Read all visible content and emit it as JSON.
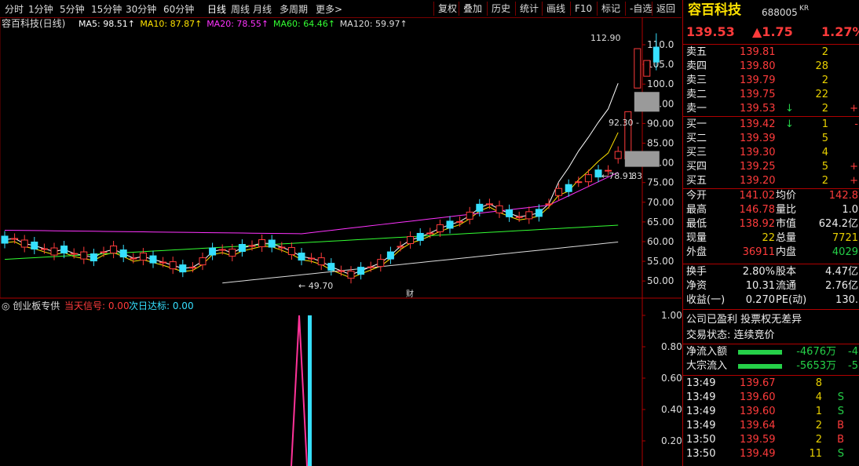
{
  "toolbar": {
    "periods": [
      "分时",
      "1分钟",
      "5分钟",
      "15分钟",
      "30分钟",
      "60分钟",
      "日线",
      "周线",
      "月线",
      "多周期",
      "更多>"
    ],
    "active_period": "日线",
    "actions": [
      "复权",
      "叠加",
      "历史",
      "统计",
      "画线",
      "F10",
      "标记",
      "-自选",
      "返回"
    ]
  },
  "chart": {
    "title": "容百科技(日线)",
    "ma_labels": [
      {
        "text": "MA5: 98.51↑",
        "color": "#ffffff"
      },
      {
        "text": "MA10: 87.87↑",
        "color": "#ffe300"
      },
      {
        "text": "MA20: 78.55↑",
        "color": "#ff33ff"
      },
      {
        "text": "MA60: 64.46↑",
        "color": "#33ff33"
      },
      {
        "text": "MA120: 59.97↑",
        "color": "#dddddd"
      }
    ],
    "y_ticks": [
      "110.0",
      "105.0",
      "100.0",
      "95.00",
      "90.00",
      "85.00",
      "80.00",
      "75.00",
      "70.00",
      "65.00",
      "60.00",
      "55.00",
      "50.00"
    ],
    "annotations": {
      "high": "112.90",
      "low": "49.70",
      "mid": "92.30",
      "gap": "78.91",
      "gap_right": "83"
    },
    "event_marker": "财"
  },
  "indicator": {
    "name": "创业板专供",
    "signal_label": "当天信号: 0.00",
    "next_label": "次日达标: 0.00",
    "y_ticks": [
      "1.00",
      "0.80",
      "0.60",
      "0.40",
      "0.20"
    ]
  },
  "quote": {
    "name": "容百科技",
    "code": "688005",
    "badge": "KR",
    "price": "139.53",
    "change": "▲1.75",
    "pct": "1.27%",
    "asks": [
      {
        "label": "卖五",
        "price": "139.81",
        "vol": "2"
      },
      {
        "label": "卖四",
        "price": "139.80",
        "vol": "28"
      },
      {
        "label": "卖三",
        "price": "139.79",
        "vol": "2"
      },
      {
        "label": "卖二",
        "price": "139.75",
        "vol": "22"
      },
      {
        "label": "卖一",
        "price": "139.53",
        "vol": "2",
        "arrow": "↓",
        "extra": "+"
      }
    ],
    "bids": [
      {
        "label": "买一",
        "price": "139.42",
        "vol": "1",
        "arrow": "↓",
        "extra": "-"
      },
      {
        "label": "买二",
        "price": "139.39",
        "vol": "5",
        "extra": ""
      },
      {
        "label": "买三",
        "price": "139.30",
        "vol": "4",
        "extra": ""
      },
      {
        "label": "买四",
        "price": "139.25",
        "vol": "5",
        "extra": "+"
      },
      {
        "label": "买五",
        "price": "139.20",
        "vol": "2",
        "extra": "+"
      }
    ],
    "stats": [
      {
        "l1": "今开",
        "v1": "141.02",
        "l2": "均价",
        "v2": "142.8"
      },
      {
        "l1": "最高",
        "v1": "146.78",
        "l2": "量比",
        "v2": "1.0"
      },
      {
        "l1": "最低",
        "v1": "138.92",
        "l2": "市值",
        "v2": "624.2亿"
      },
      {
        "l1": "现量",
        "v1": "22",
        "l2": "总量",
        "v2": "7721"
      },
      {
        "l1": "外盘",
        "v1": "36911",
        "l2": "内盘",
        "v2": "4029"
      }
    ],
    "stats2": [
      {
        "l1": "换手",
        "v1": "2.80%",
        "l2": "股本",
        "v2": "4.47亿"
      },
      {
        "l1": "净资",
        "v1": "10.31",
        "l2": "流通",
        "v2": "2.76亿"
      },
      {
        "l1": "收益(一)",
        "v1": "0.270",
        "l2": "PE(动)",
        "v2": "130."
      }
    ],
    "notes": [
      "公司已盈利 投票权无差异",
      "交易状态: 连续竞价"
    ],
    "flows": [
      {
        "label": "净流入额",
        "value": "-4676万",
        "extra": "-4"
      },
      {
        "label": "大宗流入",
        "value": "-5653万",
        "extra": "-5"
      }
    ],
    "ticks": [
      {
        "time": "13:49",
        "price": "139.67",
        "vol": "8",
        "side": ""
      },
      {
        "time": "13:49",
        "price": "139.60",
        "vol": "4",
        "side": "S"
      },
      {
        "time": "13:49",
        "price": "139.60",
        "vol": "1",
        "side": "S"
      },
      {
        "time": "13:49",
        "price": "139.64",
        "vol": "2",
        "side": "B"
      },
      {
        "time": "13:50",
        "price": "139.59",
        "vol": "2",
        "side": "B"
      },
      {
        "time": "13:50",
        "price": "139.49",
        "vol": "11",
        "side": "S"
      }
    ]
  }
}
